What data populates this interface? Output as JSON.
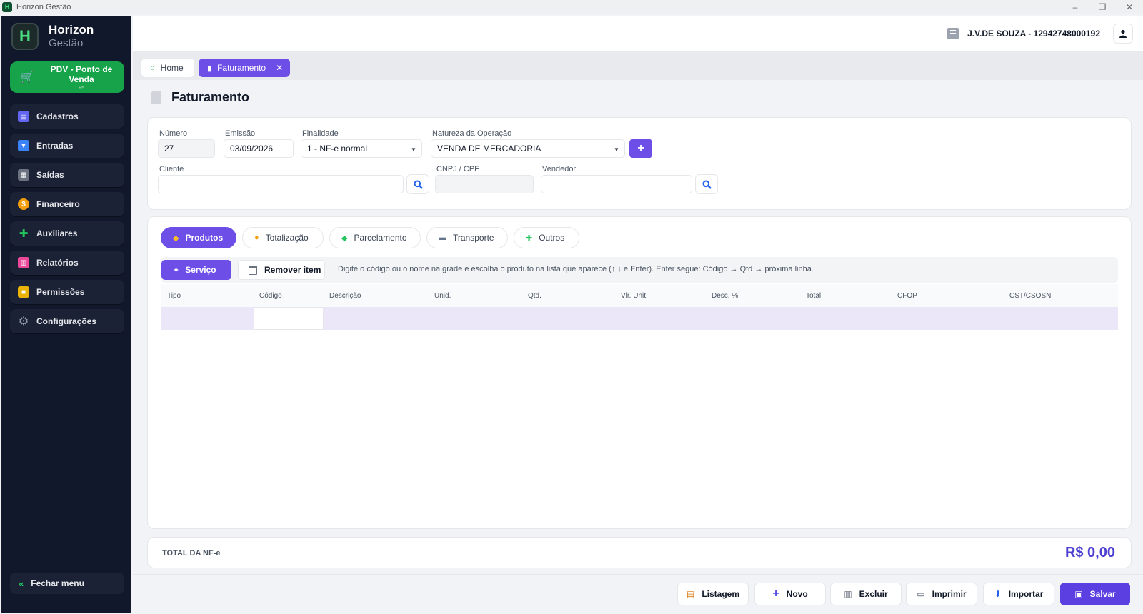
{
  "window": {
    "title": "Horizon Gestão"
  },
  "brand": {
    "name1": "Horizon",
    "name2": "Gestão",
    "logo_letter": "H"
  },
  "pdv": {
    "label": "PDV - Ponto de Venda",
    "shortcut": "F5"
  },
  "nav": [
    {
      "label": "Cadastros",
      "icon": "address-book-icon",
      "color": "#6366f1"
    },
    {
      "label": "Entradas",
      "icon": "inbox-icon",
      "color": "#3b82f6"
    },
    {
      "label": "Saídas",
      "icon": "cart-out-icon",
      "color": "#9ca3af"
    },
    {
      "label": "Financeiro",
      "icon": "money-bag-icon",
      "color": "#f59e0b"
    },
    {
      "label": "Auxiliares",
      "icon": "puzzle-icon",
      "color": "#22c55e"
    },
    {
      "label": "Relatórios",
      "icon": "bar-chart-icon",
      "color": "#ec4899"
    },
    {
      "label": "Permissões",
      "icon": "lock-icon",
      "color": "#eab308"
    },
    {
      "label": "Configurações",
      "icon": "gear-icon",
      "color": "#9ca3af"
    }
  ],
  "close_menu": "Fechar menu",
  "header": {
    "company": "J.V.DE SOUZA - 12942748000192"
  },
  "tabs": {
    "home": "Home",
    "active": "Faturamento"
  },
  "page": {
    "title": "Faturamento"
  },
  "form": {
    "numero": {
      "label": "Número",
      "value": "27"
    },
    "emissao": {
      "label": "Emissão",
      "value": "03/09/2026"
    },
    "finalidade": {
      "label": "Finalidade",
      "value": "1 - NF-e normal"
    },
    "natureza": {
      "label": "Natureza da Operação",
      "value": "VENDA DE MERCADORIA"
    },
    "cliente": {
      "label": "Cliente",
      "value": ""
    },
    "cnpj": {
      "label": "CNPJ / CPF",
      "value": ""
    },
    "vendedor": {
      "label": "Vendedor",
      "value": ""
    }
  },
  "panel_tabs": [
    {
      "label": "Produtos",
      "icon": "box-icon",
      "active": true
    },
    {
      "label": "Totalização",
      "icon": "money-bag-icon",
      "active": false
    },
    {
      "label": "Parcelamento",
      "icon": "diamond-icon",
      "active": false
    },
    {
      "label": "Transporte",
      "icon": "truck-icon",
      "active": false
    },
    {
      "label": "Outros",
      "icon": "puzzle-icon",
      "active": false
    }
  ],
  "toolbar": {
    "service_label": "Serviço",
    "remove_label": "Remover item",
    "hint": "Digite o código ou o nome na grade e escolha o produto na lista que aparece (↑ ↓ e Enter).  Enter segue: Código → Qtd → próxima linha."
  },
  "grid": {
    "columns": [
      "Tipo",
      "Código",
      "Descrição",
      "Unid.",
      "Qtd.",
      "Vlr. Unit.",
      "Desc. %",
      "Total",
      "CFOP",
      "CST/CSOSN"
    ]
  },
  "total": {
    "label": "TOTAL DA NF-e",
    "value": "R$ 0,00"
  },
  "footer": {
    "listagem": "Listagem",
    "novo": "Novo",
    "excluir": "Excluir",
    "imprimir": "Imprimir",
    "importar": "Importar",
    "salvar": "Salvar"
  },
  "colors": {
    "accent": "#6d4fe8",
    "pdv_green": "#16a34a",
    "sidebar_bg": "#12182b"
  }
}
